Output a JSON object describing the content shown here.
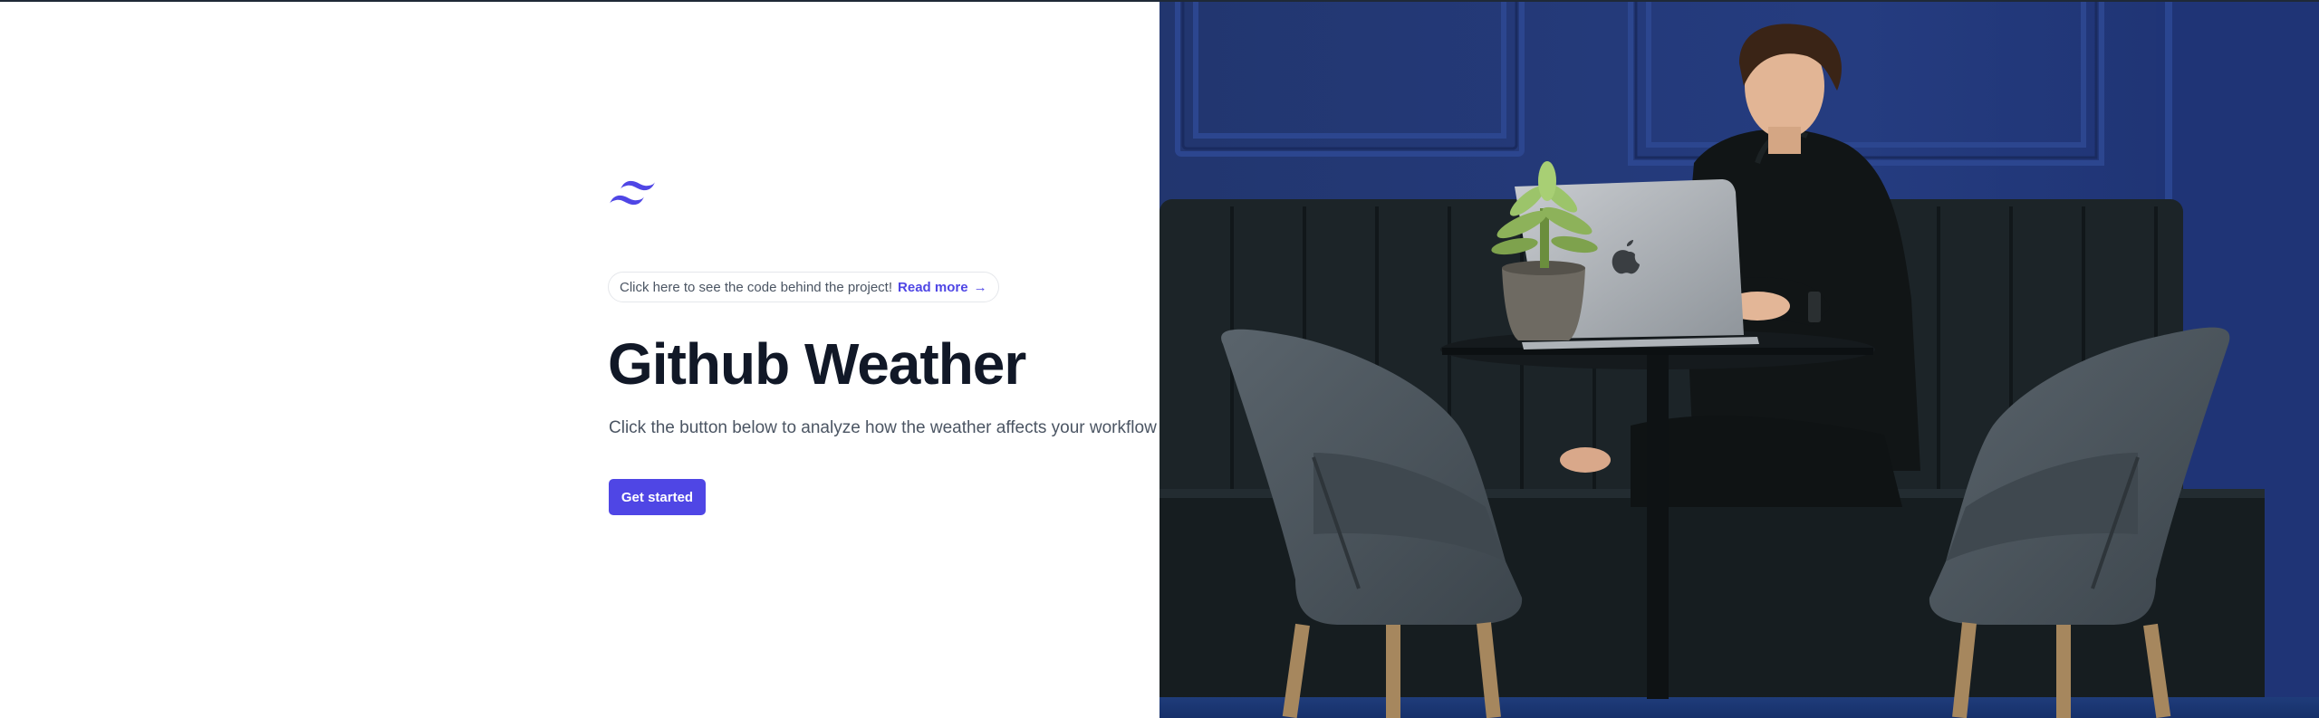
{
  "colors": {
    "accent": "#4f46e5",
    "heading": "#111827",
    "body_text": "#4b5563",
    "wall_blue": "#22387a",
    "sofa": "#1b2226",
    "chair": "#4c565e"
  },
  "logo": {
    "icon": "tailwind-wave-logo-icon"
  },
  "announcement": {
    "text": "Click here to see the code behind the project!",
    "link_label": "Read more",
    "arrow": "→"
  },
  "hero": {
    "title": "Github Weather",
    "subtitle": "Click the button below to analyze how the weather affects your workflow",
    "cta_label": "Get started"
  },
  "image": {
    "alt_description": "Man working on a laptop at a small table between two grey chairs in front of a blue paneled wall"
  }
}
